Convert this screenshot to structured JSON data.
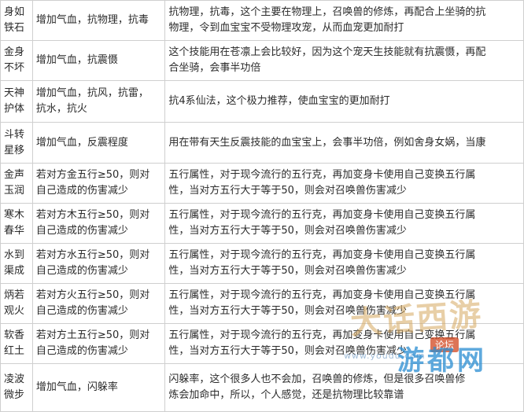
{
  "rows": [
    {
      "name": [
        "身如",
        "铁石"
      ],
      "effect": [
        "增加气血，抗物理，抗毒"
      ],
      "desc": [
        "抗物理，抗毒，这个主要在物理上，召唤兽的修炼，再配合上坐骑的抗",
        "物理，令到血宝宝不受物理攻宠，从而血宠更加耐打"
      ]
    },
    {
      "name": [
        "金身",
        "不坏"
      ],
      "effect": [
        "增加气血，抗震慑"
      ],
      "desc": [
        "这个技能用在苍凛上会比较好，因为这个宠天生技能就有抗震慑，再配",
        "合坐骑，会事半功倍"
      ]
    },
    {
      "name": [
        "天神",
        "护体"
      ],
      "effect": [
        "增加气血，抗风，抗雷，",
        "抗水，抗火"
      ],
      "desc": [
        "抗4系仙法，这个极力推荐，使血宝宝的更加耐打"
      ]
    },
    {
      "name": [
        "斗转",
        "星移"
      ],
      "effect": [
        "增加气血，反震程度"
      ],
      "desc": [
        "用在带有天生反震技能的血宝宝上，会事半功倍，例如舍身女娲，当康"
      ]
    },
    {
      "name": [
        "金声",
        "玉润"
      ],
      "effect": [
        "若对方金五行≥50，则对",
        "自己造成的伤害减少"
      ],
      "desc": [
        "五行属性，对于现今流行的五行克，再加变身卡使用自己变换五行属",
        "性，当对方五行大于等于50，则会对召唤兽伤害减少"
      ]
    },
    {
      "name": [
        "寒木",
        "春华"
      ],
      "effect": [
        "若对方木五行≥50，则对",
        "自己造成的伤害减少"
      ],
      "desc": [
        "五行属性，对于现今流行的五行克，再加变身卡使用自己变换五行属",
        "性，当对方五行大于等于50，则会对召唤兽伤害减少"
      ]
    },
    {
      "name": [
        "水到",
        "渠成"
      ],
      "effect": [
        "若对方水五行≥50，则对",
        "自己造成的伤害减少"
      ],
      "desc": [
        "五行属性，对于现今流行的五行克，再加变身卡使用自己变换五行属",
        "性，当对方五行大于等于50，则会对召唤兽伤害减少"
      ]
    },
    {
      "name": [
        "炳若",
        "观火"
      ],
      "effect": [
        "若对方火五行≥50，则对",
        "自己造成的伤害减少"
      ],
      "desc": [
        "五行属性，对于现今流行的五行克，再加变身卡使用自己变换五行属",
        "性，当对方五行大于等于50，则会对召唤兽伤害减少"
      ]
    },
    {
      "name": [
        "软香",
        "红土"
      ],
      "effect": [
        "若对方土五行≥50，则对",
        "自己造成的伤害减少"
      ],
      "desc": [
        "五行属性，对于现今流行的五行克，再加变身卡使用自己变换五行属",
        "性，当对方五行大于等于50，则会对召唤兽伤害减少"
      ]
    },
    {
      "name": [
        "凌波",
        "微步"
      ],
      "effect": [
        "增加气血，闪躲率"
      ],
      "desc": [
        "闪躲率，这个很多人也不会加，召唤兽的修炼，但是很多召唤兽修",
        "炼会加命中，所以，个人感觉，还是抗物理比较靠谱"
      ]
    }
  ],
  "watermark": {
    "title": "大话西游",
    "badge": "论坛",
    "logo": "游都网",
    "url": "www.youdu.com"
  }
}
